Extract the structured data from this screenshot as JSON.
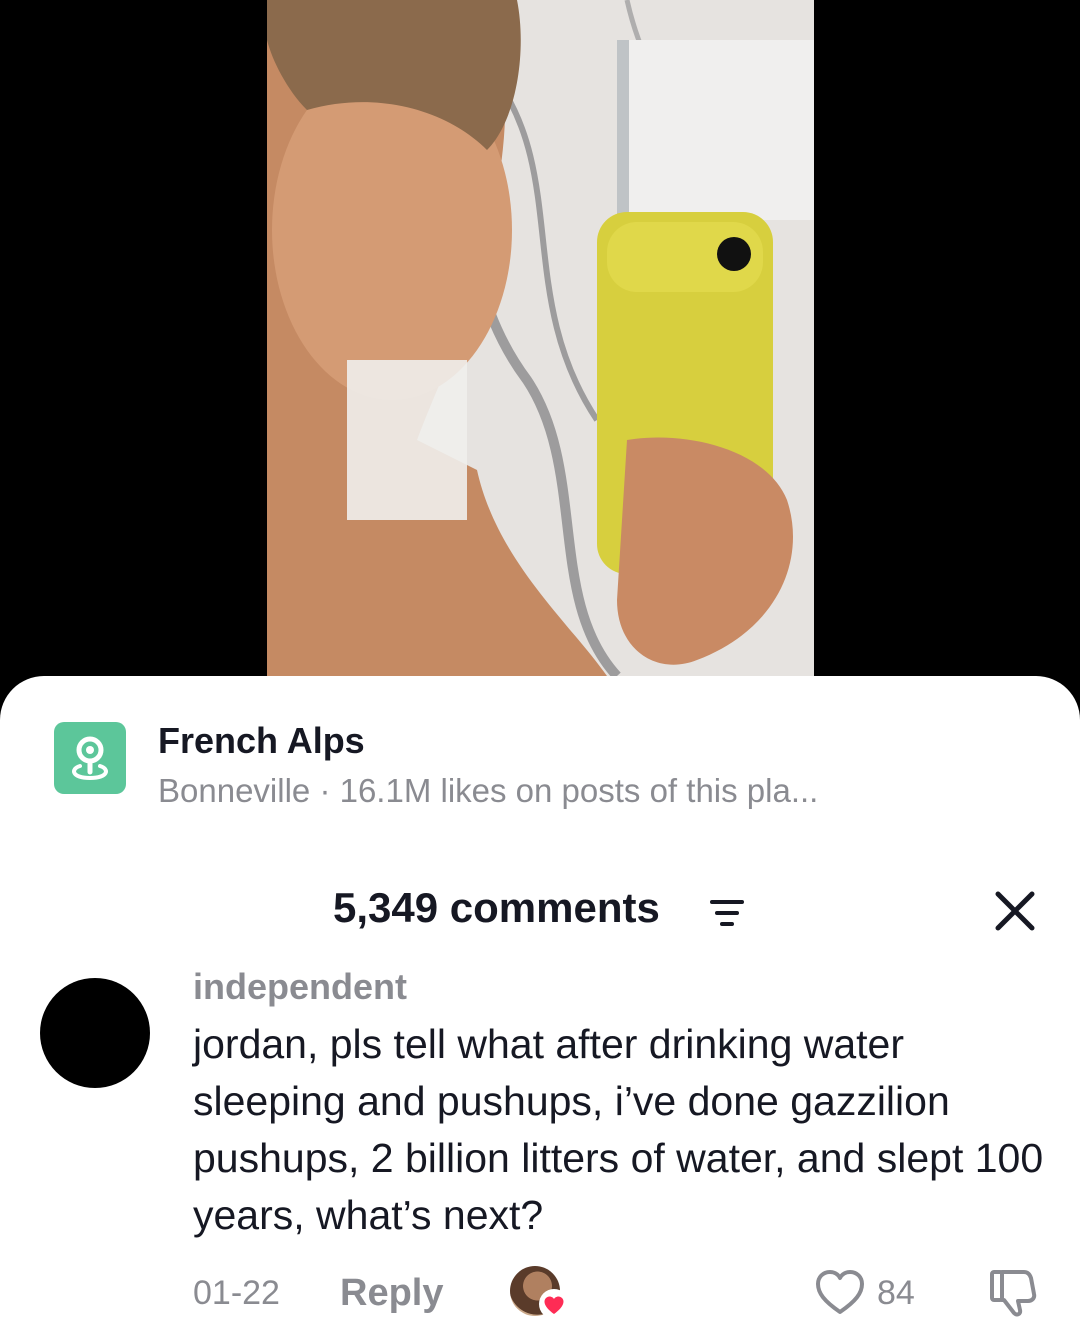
{
  "video": {},
  "location": {
    "title": "French Alps",
    "subtitle": "Bonneville · 16.1M likes on posts of this pla...",
    "icon": "location-pin-icon",
    "icon_color": "#5cc69a"
  },
  "comments_header": {
    "count_label": "5,349 comments",
    "filter_icon": "filter-icon",
    "close_icon": "close-icon"
  },
  "comment": {
    "username": "independent",
    "text": "jordan, pls tell what after drinking water sleeping and pushups, i’ve done gazzilion pushups, 2 billion litters of water, and slept 100 years, what’s next?",
    "date": "01-22",
    "reply_label": "Reply",
    "creator_liked": true,
    "like_count": "84"
  },
  "colors": {
    "text_primary": "#161823",
    "text_secondary": "#8a8b91",
    "heart": "#fe2c55"
  }
}
